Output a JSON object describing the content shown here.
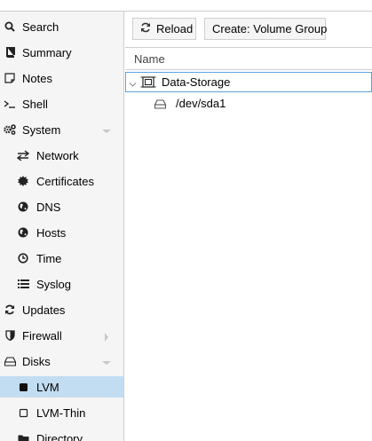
{
  "sidebar": {
    "items": [
      {
        "label": "Search",
        "icon": "search-icon"
      },
      {
        "label": "Summary",
        "icon": "book-icon"
      },
      {
        "label": "Notes",
        "icon": "note-icon"
      },
      {
        "label": "Shell",
        "icon": "terminal-icon"
      },
      {
        "label": "System",
        "icon": "gears-icon"
      },
      {
        "label": "Network",
        "icon": "exchange-icon"
      },
      {
        "label": "Certificates",
        "icon": "certificate-icon"
      },
      {
        "label": "DNS",
        "icon": "globe-icon"
      },
      {
        "label": "Hosts",
        "icon": "globe-icon"
      },
      {
        "label": "Time",
        "icon": "clock-icon"
      },
      {
        "label": "Syslog",
        "icon": "list-icon"
      },
      {
        "label": "Updates",
        "icon": "refresh-icon"
      },
      {
        "label": "Firewall",
        "icon": "shield-icon"
      },
      {
        "label": "Disks",
        "icon": "hdd-icon"
      },
      {
        "label": "LVM",
        "icon": "square-filled-icon"
      },
      {
        "label": "LVM-Thin",
        "icon": "square-outline-icon"
      },
      {
        "label": "Directory",
        "icon": "folder-icon"
      }
    ],
    "active_label": "LVM"
  },
  "toolbar": {
    "reload_label": "Reload",
    "create_label": "Create: Volume Group"
  },
  "grid": {
    "column_name": "Name",
    "rows": [
      {
        "label": "Data-Storage",
        "icon": "volume-group-icon"
      },
      {
        "label": "/dev/sda1",
        "icon": "hdd-icon"
      }
    ]
  },
  "colors": {
    "active_bg": "#c2ddf2",
    "selected_border": "#5fa2dd",
    "sidebar_bg": "#f5f5f5"
  }
}
